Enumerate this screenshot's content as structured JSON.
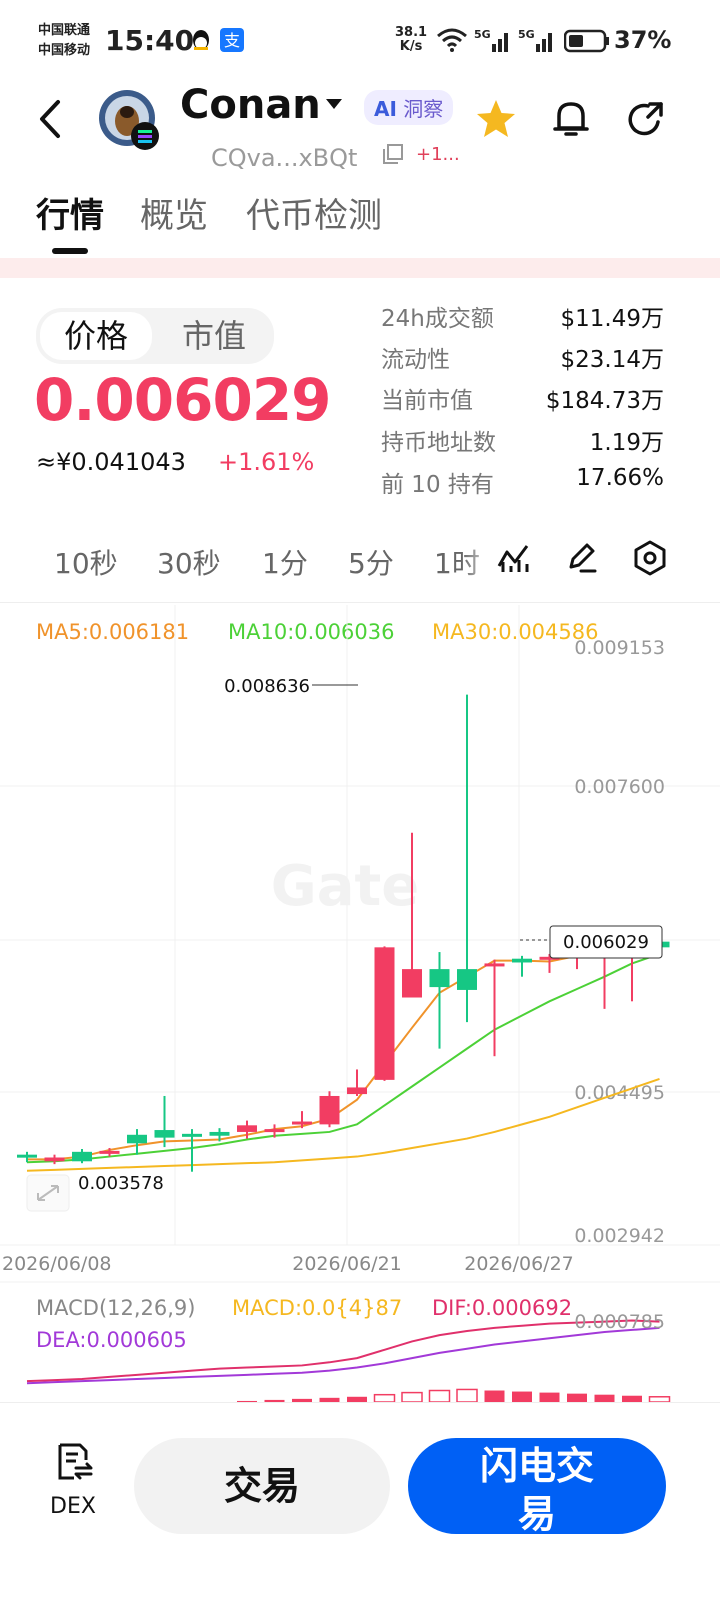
{
  "status_bar": {
    "carrier1": "中国联通",
    "carrier2": "中国移动",
    "time": "15:40",
    "net_speed_top": "38.1",
    "net_speed_bottom": "K/s",
    "battery": "37%"
  },
  "header": {
    "coin_name": "Conan",
    "ai_badge": "洞察",
    "address": "CQva...xBQt",
    "address_extra": "+1..."
  },
  "tabs": [
    {
      "label": "行情",
      "active": true
    },
    {
      "label": "概览",
      "active": false
    },
    {
      "label": "代币检测",
      "active": false
    }
  ],
  "price_panel": {
    "toggle": [
      "价格",
      "市值"
    ],
    "price": "0.006029",
    "price_cny": "≈¥0.041043",
    "change": "+1.61%"
  },
  "stats": [
    {
      "label": "24h成交额",
      "value": "$11.49万"
    },
    {
      "label": "流动性",
      "value": "$23.14万"
    },
    {
      "label": "当前市值",
      "value": "$184.73万"
    },
    {
      "label": "持币地址数",
      "value": "1.19万"
    },
    {
      "label": "前 10 持有",
      "value": "17.66%"
    }
  ],
  "intervals": [
    "10秒",
    "30秒",
    "1分",
    "5分",
    "1时"
  ],
  "ma_legend": {
    "ma5": "MA5:0.006181",
    "ma10": "MA10:0.006036",
    "ma30": "MA30:0.004586"
  },
  "colors": {
    "up": "#16c784",
    "down": "#f23d62",
    "ma5": "#f0932b",
    "ma10": "#4cd137",
    "ma30": "#f5b820",
    "dif": "#e0306b",
    "dea": "#a239d8",
    "accent": "#0060f5"
  },
  "chart_data": {
    "type": "candlestick",
    "y_ticks": [
      "0.009153",
      "0.007600",
      "0.004495",
      "0.002942"
    ],
    "x_ticks": [
      "2026/06/08",
      "2026/06/21",
      "2026/06/27"
    ],
    "max_label": "0.008636",
    "min_label": "0.003578",
    "current_label": "0.006029",
    "ylim": [
      0.0028,
      0.0092
    ],
    "candles": [
      {
        "o": 0.00376,
        "h": 0.00381,
        "l": 0.0037,
        "c": 0.00378
      },
      {
        "o": 0.00375,
        "h": 0.00378,
        "l": 0.00368,
        "c": 0.00371
      },
      {
        "o": 0.00371,
        "h": 0.00384,
        "l": 0.00369,
        "c": 0.00381
      },
      {
        "o": 0.00382,
        "h": 0.00385,
        "l": 0.00376,
        "c": 0.00379
      },
      {
        "o": 0.0039,
        "h": 0.00405,
        "l": 0.00378,
        "c": 0.00399
      },
      {
        "o": 0.00396,
        "h": 0.0044,
        "l": 0.00386,
        "c": 0.00404
      },
      {
        "o": 0.00399,
        "h": 0.00405,
        "l": 0.0036,
        "c": 0.004
      },
      {
        "o": 0.00398,
        "h": 0.00406,
        "l": 0.00392,
        "c": 0.00402
      },
      {
        "o": 0.00409,
        "h": 0.00414,
        "l": 0.00395,
        "c": 0.00402
      },
      {
        "o": 0.00405,
        "h": 0.0041,
        "l": 0.00396,
        "c": 0.00404
      },
      {
        "o": 0.00413,
        "h": 0.00424,
        "l": 0.00406,
        "c": 0.0041
      },
      {
        "o": 0.0044,
        "h": 0.00445,
        "l": 0.00407,
        "c": 0.0041
      },
      {
        "o": 0.00449,
        "h": 0.00468,
        "l": 0.0044,
        "c": 0.00442
      },
      {
        "o": 0.00597,
        "h": 0.00598,
        "l": 0.00456,
        "c": 0.00457
      },
      {
        "o": 0.00574,
        "h": 0.00718,
        "l": 0.00544,
        "c": 0.00544
      },
      {
        "o": 0.00555,
        "h": 0.00592,
        "l": 0.0049,
        "c": 0.00574
      },
      {
        "o": 0.00552,
        "h": 0.00864,
        "l": 0.00518,
        "c": 0.00574
      },
      {
        "o": 0.0058,
        "h": 0.00584,
        "l": 0.00482,
        "c": 0.00579
      },
      {
        "o": 0.00581,
        "h": 0.00588,
        "l": 0.00566,
        "c": 0.00585
      },
      {
        "o": 0.00587,
        "h": 0.0059,
        "l": 0.0057,
        "c": 0.00585
      },
      {
        "o": 0.0059,
        "h": 0.00598,
        "l": 0.00574,
        "c": 0.00587
      },
      {
        "o": 0.00592,
        "h": 0.00614,
        "l": 0.00532,
        "c": 0.0059
      },
      {
        "o": 0.00605,
        "h": 0.00614,
        "l": 0.0054,
        "c": 0.00594
      },
      {
        "o": 0.00597,
        "h": 0.00614,
        "l": 0.0059,
        "c": 0.00603
      }
    ],
    "ma5": [
      0.00373,
      0.00373,
      0.00376,
      0.00383,
      0.00388,
      0.00392,
      0.00393,
      0.00394,
      0.00399,
      0.00405,
      0.00408,
      0.00416,
      0.00436,
      0.00474,
      0.00512,
      0.00549,
      0.00566,
      0.00583,
      0.00583,
      0.00582,
      0.00588,
      0.0059,
      0.00594,
      0.00599
    ],
    "ma10": [
      0.0037,
      0.00371,
      0.00373,
      0.00376,
      0.00379,
      0.00382,
      0.00385,
      0.00389,
      0.00394,
      0.00398,
      0.004,
      0.00402,
      0.0041,
      0.0043,
      0.0045,
      0.0047,
      0.0049,
      0.0051,
      0.00525,
      0.0054,
      0.00553,
      0.00566,
      0.0058,
      0.0059
    ],
    "ma30": [
      0.00361,
      0.00362,
      0.00363,
      0.00364,
      0.00365,
      0.00366,
      0.00367,
      0.00368,
      0.00369,
      0.0037,
      0.00372,
      0.00374,
      0.00376,
      0.0038,
      0.00385,
      0.0039,
      0.00395,
      0.00402,
      0.0041,
      0.00418,
      0.00428,
      0.00438,
      0.00448,
      0.00458
    ],
    "macd_legend": {
      "params": "MACD(12,26,9)",
      "macd": "MACD:0.0{4}87",
      "dif": "DIF:0.000692",
      "dea": "DEA:0.000605",
      "axis_top": "0.000785"
    },
    "macd_hist": [
      0,
      0,
      0,
      0,
      0,
      0,
      0,
      0,
      1e-05,
      2e-05,
      3e-05,
      4e-05,
      5e-05,
      7e-05,
      9e-05,
      0.00011,
      0.00012,
      0.00011,
      0.0001,
      9e-05,
      8e-05,
      7e-05,
      6e-05,
      5e-05
    ],
    "macd_hist_up": [
      false,
      false,
      false,
      false,
      false,
      false,
      false,
      false,
      false,
      false,
      false,
      false,
      false,
      true,
      true,
      true,
      true,
      false,
      false,
      false,
      false,
      false,
      false,
      true
    ],
    "dif": [
      0.0002,
      0.00021,
      0.00022,
      0.00024,
      0.00026,
      0.00028,
      0.0003,
      0.00032,
      0.00033,
      0.00034,
      0.00035,
      0.00038,
      0.00042,
      0.0005,
      0.00058,
      0.00064,
      0.00068,
      0.00071,
      0.00073,
      0.00075,
      0.00076,
      0.00077,
      0.00078,
      0.00077
    ],
    "dea": [
      0.00018,
      0.00019,
      0.0002,
      0.00021,
      0.00022,
      0.00023,
      0.00024,
      0.00025,
      0.00026,
      0.00027,
      0.00028,
      0.0003,
      0.00033,
      0.00037,
      0.00042,
      0.00047,
      0.00051,
      0.00055,
      0.00058,
      0.00061,
      0.00064,
      0.00067,
      0.00069,
      0.00071
    ]
  },
  "watermark": "Gate",
  "bottom_bar": {
    "dex_label": "DEX",
    "trade": "交易",
    "flash_trade": "闪电交易"
  }
}
